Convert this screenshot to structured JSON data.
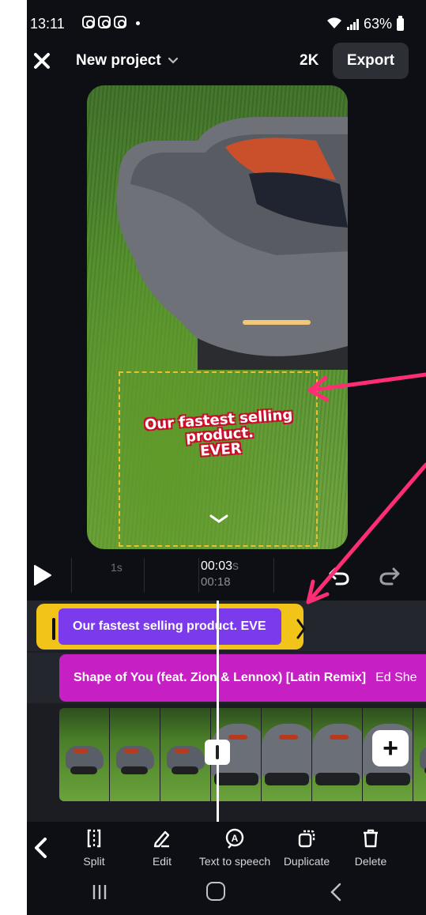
{
  "status_bar": {
    "time": "13:11",
    "battery": "63%"
  },
  "header": {
    "title": "New project",
    "resolution": "2K",
    "export_label": "Export"
  },
  "preview": {
    "overlay_text": "Our fastest selling\nproduct.\nEVER"
  },
  "playback": {
    "ruler_label": "1s",
    "current_time": "00:03",
    "current_time_suffix": "s",
    "total_time": "00:18"
  },
  "timeline": {
    "text_clip": "Our fastest selling product. EVE",
    "music_title": "Shape of You (feat. Zion & Lennox) [Latin Remix]",
    "music_artist": "Ed She"
  },
  "toolbar": {
    "tools": [
      {
        "label": "Split",
        "icon": "split-icon"
      },
      {
        "label": "Edit",
        "icon": "pen-icon"
      },
      {
        "label": "Text to speech",
        "icon": "text-to-speech-icon"
      },
      {
        "label": "Duplicate",
        "icon": "duplicate-icon"
      },
      {
        "label": "Delete",
        "icon": "trash-icon"
      }
    ]
  },
  "colors": {
    "background": "#0d0f14",
    "text_clip": "#7c3aed",
    "selection_frame": "#f2c318",
    "music_clip": "#c61fc3",
    "annotation_arrow": "#ff2e74"
  }
}
